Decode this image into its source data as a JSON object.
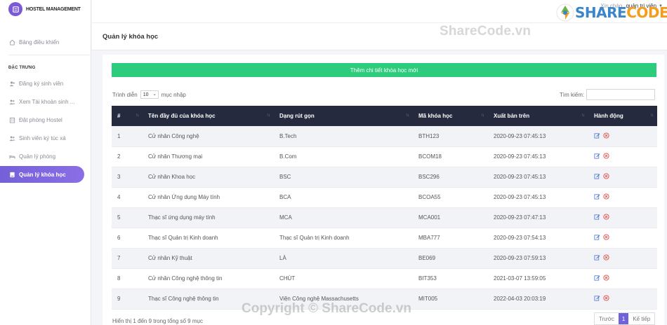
{
  "brand": {
    "name": "HOSTEL MANAGEMENT"
  },
  "header": {
    "greeting": "Xin chào,",
    "user": "quản trị viên",
    "brandmark_a": "SHARE",
    "brandmark_b": "CODE.vn"
  },
  "sidebar": {
    "dashboard": "Bảng điều khiển",
    "section": "ĐẶC TRƯNG",
    "items": [
      {
        "label": "Đăng ký sinh viên"
      },
      {
        "label": "Xem Tài khoản sinh ..."
      },
      {
        "label": "Đặt phòng Hostel"
      },
      {
        "label": "Sinh viên ký túc xá"
      },
      {
        "label": "Quản lý phòng"
      },
      {
        "label": "Quản lý khóa học"
      }
    ]
  },
  "page": {
    "title": "Quản lý khóa học",
    "add_label": "Thêm chi tiết khóa học mới"
  },
  "controls": {
    "length_prefix": "Trình diễn",
    "length_value": "10",
    "length_suffix": "mục nhập",
    "search_label": "Tìm kiếm:"
  },
  "table": {
    "headers": [
      "#",
      "Tên đầy đủ của khóa học",
      "Dạng rút gọn",
      "Mã khóa học",
      "Xuất bản trên",
      "Hành động"
    ],
    "rows": [
      [
        "1",
        "Cử nhân Công nghệ",
        "B.Tech",
        "BTH123",
        "2020-09-23 07:45:13"
      ],
      [
        "2",
        "Cử nhân Thương mại",
        "B.Com",
        "BCOM18",
        "2020-09-23 07:45:13"
      ],
      [
        "3",
        "Cử nhân Khoa học",
        "BSC",
        "BSC296",
        "2020-09-23 07:45:13"
      ],
      [
        "4",
        "Cử nhân Ứng dụng Máy tính",
        "BCA",
        "BCOA55",
        "2020-09-23 07:45:13"
      ],
      [
        "5",
        "Thạc sĩ ứng dụng máy tính",
        "MCA",
        "MCA001",
        "2020-09-23 07:47:13"
      ],
      [
        "6",
        "Thạc sĩ Quản trị Kinh doanh",
        "Thạc sĩ Quản trị Kinh doanh",
        "MBA777",
        "2020-09-23 07:54:13"
      ],
      [
        "7",
        "Cử nhân Kỹ thuật",
        "LÀ",
        "BE069",
        "2020-09-23 07:59:13"
      ],
      [
        "8",
        "Cử nhân Công nghệ thông tin",
        "CHÚT",
        "BIT353",
        "2021-03-07 13:59:05"
      ],
      [
        "9",
        "Thạc sĩ Công nghệ thông tin",
        "Viện Công nghệ Massachusetts",
        "MIT005",
        "2022-04-03 20:03:19"
      ]
    ]
  },
  "footer": {
    "info": "Hiển thị 1 đến 9 trong tổng số 9 mục",
    "prev": "Trước",
    "page": "1",
    "next": "Kế tiếp"
  },
  "watermarks": {
    "top": "ShareCode.vn",
    "bottom": "Copyright © ShareCode.vn"
  },
  "colors": {
    "accent": "#7b5ad6",
    "add_button": "#2dcc7c",
    "table_header": "#252a3e",
    "edit_icon": "#4a74d6",
    "delete_icon": "#e0443f"
  }
}
